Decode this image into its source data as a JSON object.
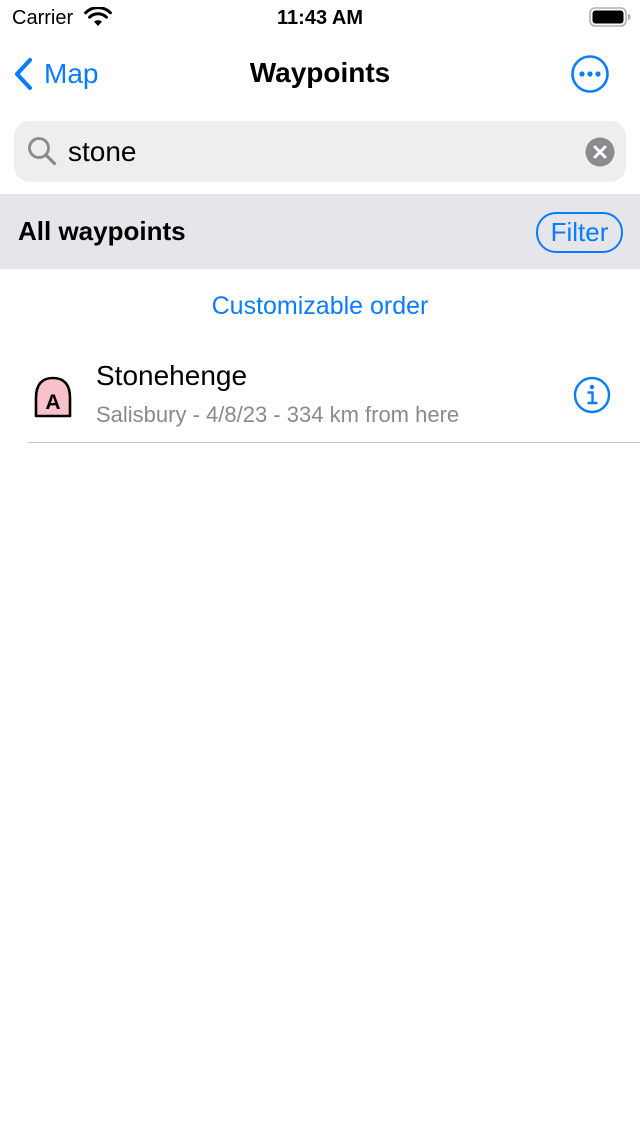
{
  "status_bar": {
    "carrier": "Carrier",
    "time": "11:43 AM"
  },
  "nav": {
    "back_label": "Map",
    "title": "Waypoints"
  },
  "search": {
    "value": "stone"
  },
  "section": {
    "title": "All waypoints",
    "filter_label": "Filter"
  },
  "order_link": "Customizable order",
  "waypoints": [
    {
      "name": "Stonehenge",
      "details": "Salisbury - 4/8/23 - 334 km from here",
      "marker_letter": "A"
    }
  ],
  "icons": {
    "wifi": "wifi-icon",
    "battery": "battery-icon",
    "back": "chevron-left-icon",
    "more": "ellipsis-circle-icon",
    "search": "search-icon",
    "clear": "clear-icon",
    "marker": "waypoint-marker-icon",
    "info": "info-icon"
  },
  "colors": {
    "accent": "#0a7cff",
    "marker_fill": "#f9c2cb",
    "section_background": "#e5e5ea",
    "search_background": "#eeeeef",
    "secondary_text": "#8a8a8e"
  }
}
